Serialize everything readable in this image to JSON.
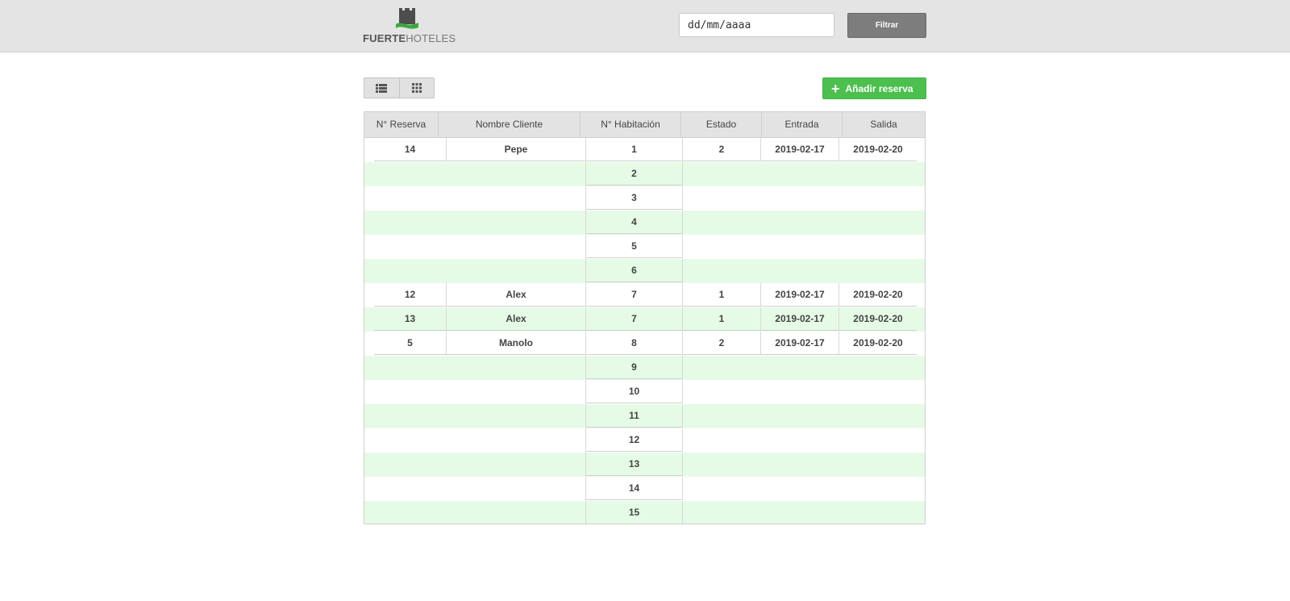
{
  "header": {
    "logo_bold": "FUERTE",
    "logo_light": "HOTELES",
    "date_placeholder": "dd/mm/aaaa",
    "filter_label": "Filtrar"
  },
  "toolbar": {
    "list_view_icon": "list-icon",
    "grid_view_icon": "grid-icon",
    "add_label": "Añadir reserva"
  },
  "colors": {
    "accent_green": "#4cbf4f",
    "row_alt": "#e6fbe6",
    "header_bg": "#e4e4e4"
  },
  "table": {
    "columns": [
      "N° Reserva",
      "Nombre Cliente",
      "N° Habitación",
      "Estado",
      "Entrada",
      "Salida"
    ],
    "rows": [
      {
        "reserva": "14",
        "cliente": "Pepe",
        "habitacion": "1",
        "estado": "2",
        "entrada": "2019-02-17",
        "salida": "2019-02-20"
      },
      {
        "reserva": "",
        "cliente": "",
        "habitacion": "2",
        "estado": "",
        "entrada": "",
        "salida": ""
      },
      {
        "reserva": "",
        "cliente": "",
        "habitacion": "3",
        "estado": "",
        "entrada": "",
        "salida": ""
      },
      {
        "reserva": "",
        "cliente": "",
        "habitacion": "4",
        "estado": "",
        "entrada": "",
        "salida": ""
      },
      {
        "reserva": "",
        "cliente": "",
        "habitacion": "5",
        "estado": "",
        "entrada": "",
        "salida": ""
      },
      {
        "reserva": "",
        "cliente": "",
        "habitacion": "6",
        "estado": "",
        "entrada": "",
        "salida": ""
      },
      {
        "reserva": "12",
        "cliente": "Alex",
        "habitacion": "7",
        "estado": "1",
        "entrada": "2019-02-17",
        "salida": "2019-02-20"
      },
      {
        "reserva": "13",
        "cliente": "Alex",
        "habitacion": "7",
        "estado": "1",
        "entrada": "2019-02-17",
        "salida": "2019-02-20"
      },
      {
        "reserva": "5",
        "cliente": "Manolo",
        "habitacion": "8",
        "estado": "2",
        "entrada": "2019-02-17",
        "salida": "2019-02-20"
      },
      {
        "reserva": "",
        "cliente": "",
        "habitacion": "9",
        "estado": "",
        "entrada": "",
        "salida": ""
      },
      {
        "reserva": "",
        "cliente": "",
        "habitacion": "10",
        "estado": "",
        "entrada": "",
        "salida": ""
      },
      {
        "reserva": "",
        "cliente": "",
        "habitacion": "11",
        "estado": "",
        "entrada": "",
        "salida": ""
      },
      {
        "reserva": "",
        "cliente": "",
        "habitacion": "12",
        "estado": "",
        "entrada": "",
        "salida": ""
      },
      {
        "reserva": "",
        "cliente": "",
        "habitacion": "13",
        "estado": "",
        "entrada": "",
        "salida": ""
      },
      {
        "reserva": "",
        "cliente": "",
        "habitacion": "14",
        "estado": "",
        "entrada": "",
        "salida": ""
      },
      {
        "reserva": "",
        "cliente": "",
        "habitacion": "15",
        "estado": "",
        "entrada": "",
        "salida": ""
      }
    ]
  }
}
